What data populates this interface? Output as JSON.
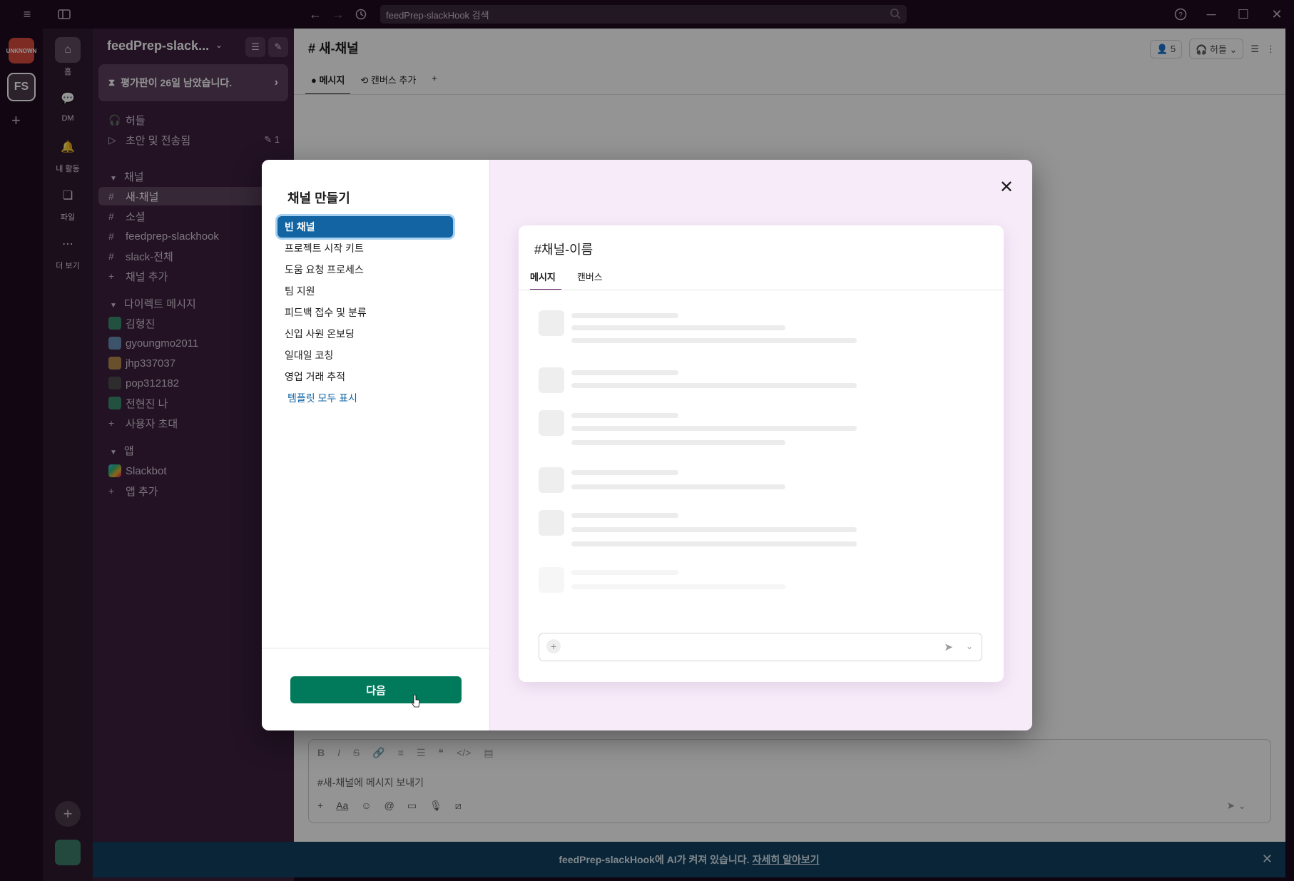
{
  "titlebar": {
    "search_placeholder": "feedPrep-slackHook 검색"
  },
  "rail": {
    "workspace_initials": "FS",
    "logo_text": "UNKNOWN"
  },
  "nav": {
    "home": "홈",
    "dm": "DM",
    "activity": "내 활동",
    "files": "파일",
    "more": "더 보기"
  },
  "sidebar": {
    "workspace_name": "feedPrep-slack...",
    "trial_banner": "평가판이 26일 남았습니다.",
    "huddle": "허들",
    "drafts": "초안 및 전송됨",
    "drafts_count": "1",
    "channels_header": "채널",
    "channels": [
      {
        "label": "새-채널"
      },
      {
        "label": "소셜"
      },
      {
        "label": "feedprep-slackhook"
      },
      {
        "label": "slack-전체"
      }
    ],
    "add_channel": "채널 추가",
    "dm_header": "다이렉트 메시지",
    "dms": [
      {
        "label": "김형진"
      },
      {
        "label": "gyoungmo2011"
      },
      {
        "label": "jhp337037"
      },
      {
        "label": "pop312182"
      },
      {
        "label": "전현진  나"
      }
    ],
    "invite": "사용자 초대",
    "apps_header": "앱",
    "slackbot": "Slackbot",
    "add_app": "앱 추가"
  },
  "main": {
    "channel_title": "# 새-채널",
    "tab_messages": "메시지",
    "tab_canvas": "캔버스 추가",
    "member_count": "5",
    "huddle_label": "허들",
    "composer_placeholder": "#새-채널에 메시지 보내기"
  },
  "banner": {
    "text": "feedPrep-slackHook에 AI가 켜져 있습니다.",
    "link": "자세히 알아보기"
  },
  "modal": {
    "title": "채널 만들기",
    "templates": [
      {
        "label": "빈 채널"
      },
      {
        "label": "프로젝트 시작 키트"
      },
      {
        "label": "도움 요청 프로세스"
      },
      {
        "label": "팀 지원"
      },
      {
        "label": "피드백 접수 및 분류"
      },
      {
        "label": "신입 사원 온보딩"
      },
      {
        "label": "일대일 코칭"
      },
      {
        "label": "영업 거래 추적"
      }
    ],
    "show_all": "템플릿 모두 표시",
    "next_button": "다음",
    "preview": {
      "title": "#채널-이름",
      "tab_messages": "메시지",
      "tab_canvas": "캔버스"
    }
  },
  "colors": {
    "aubergine": "#3b1f3e",
    "selected_blue": "#1264a3",
    "next_green": "#007a5a",
    "preview_bg": "#f7ebf9",
    "banner_blue": "#12405f"
  }
}
